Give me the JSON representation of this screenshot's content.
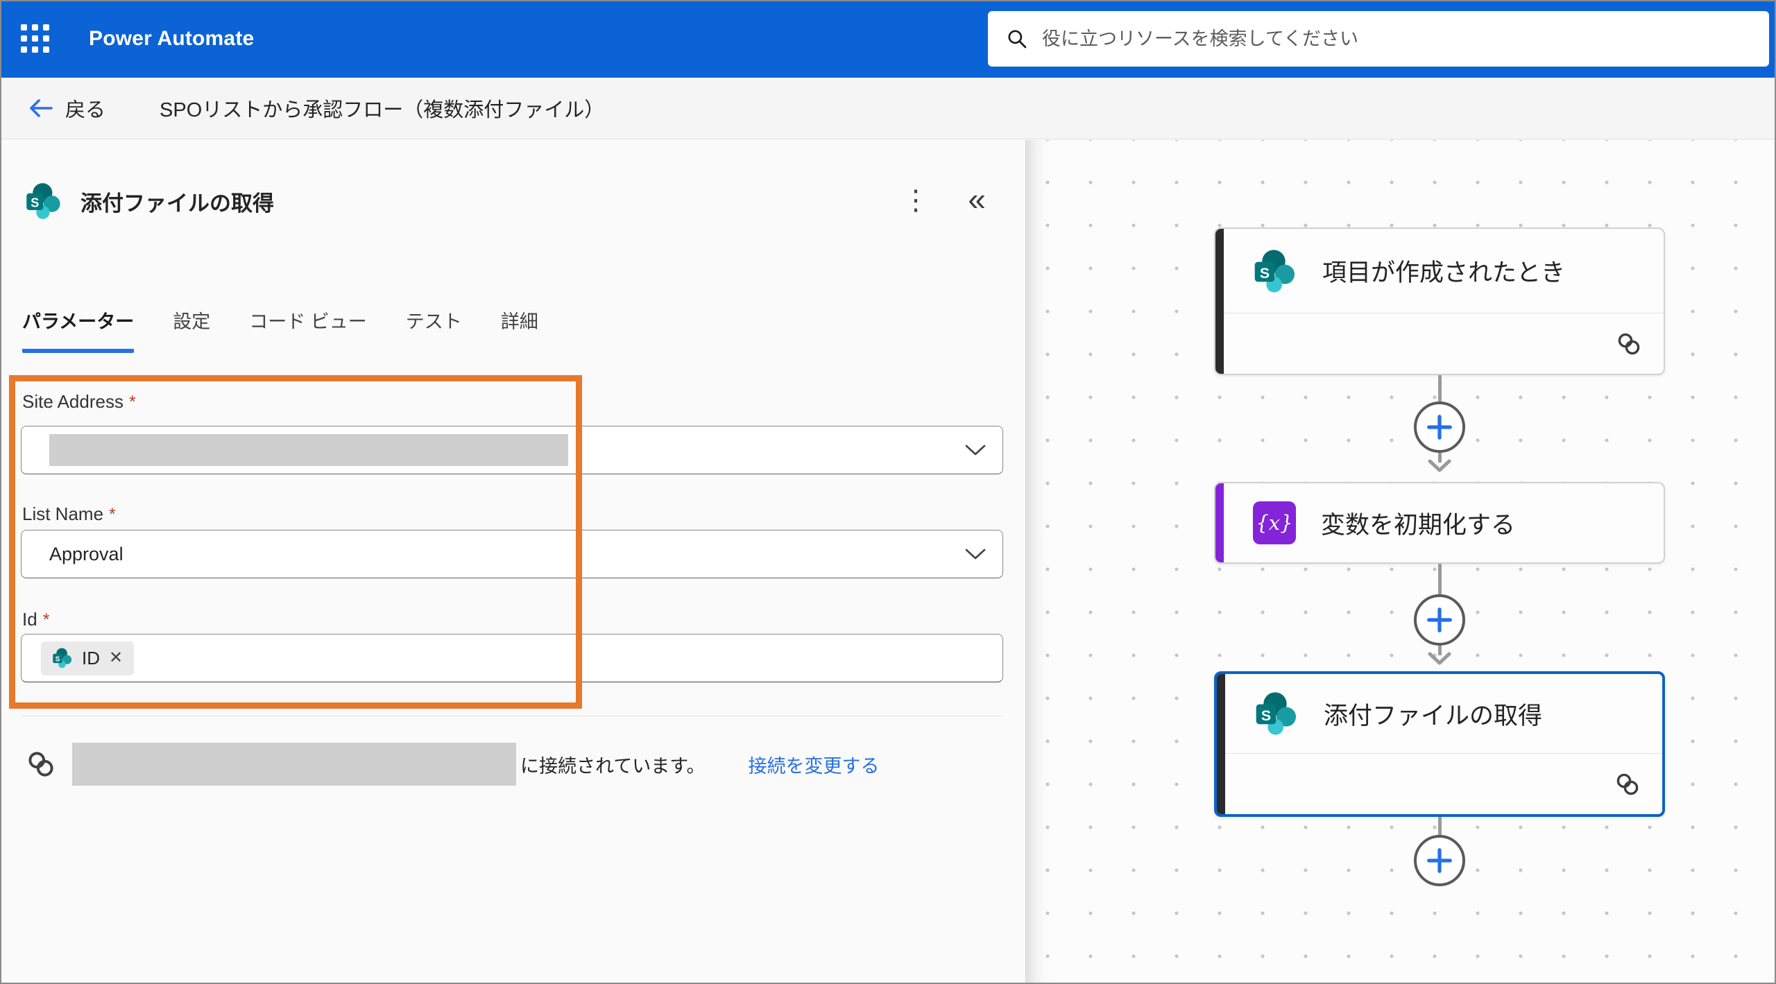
{
  "topbar": {
    "app_title": "Power Automate",
    "search_placeholder": "役に立つリソースを検索してください"
  },
  "breadcrumb": {
    "back_label": "戻る",
    "flow_title": "SPOリストから承認フロー（複数添付ファイル）"
  },
  "panel": {
    "title": "添付ファイルの取得",
    "tabs": [
      {
        "label": "パラメーター",
        "active": true
      },
      {
        "label": "設定",
        "active": false
      },
      {
        "label": "コード ビュー",
        "active": false
      },
      {
        "label": "テスト",
        "active": false
      },
      {
        "label": "詳細",
        "active": false
      }
    ],
    "fields": {
      "site_address": {
        "label": "Site Address",
        "required_mark": "*",
        "value": "",
        "value_redacted": true
      },
      "list_name": {
        "label": "List Name",
        "required_mark": "*",
        "value": "Approval"
      },
      "id": {
        "label": "Id",
        "required_mark": "*",
        "token": {
          "text": "ID",
          "remove_label": "✕",
          "icon": "sharepoint-icon"
        }
      }
    },
    "connection": {
      "account_redacted": true,
      "status_text": "に接続されています。",
      "change_link_label": "接続を変更する"
    }
  },
  "canvas": {
    "nodes": [
      {
        "title": "項目が作成されたとき",
        "icon": "sharepoint-icon",
        "accent_color": "#2B2B2B",
        "selected": false,
        "footer_link_icon": true
      },
      {
        "title": "変数を初期化する",
        "icon": "variable-icon",
        "accent_color": "#8324D9",
        "selected": false,
        "footer_link_icon": false
      },
      {
        "title": "添付ファイルの取得",
        "icon": "sharepoint-icon",
        "accent_color": "#2B2B2B",
        "selected": true,
        "footer_link_icon": true
      }
    ]
  },
  "icons": {
    "more": "⋮",
    "collapse": "«",
    "variable_glyph": "{x}"
  },
  "colors": {
    "brand_blue": "#0C63D6",
    "selected_node_blue": "#0E62C9",
    "action_blue": "#2470E4",
    "highlight_orange": "#E8782C",
    "variable_purple": "#8324D9",
    "sharepoint_teal_dark": "#036C70",
    "sharepoint_teal_mid": "#1A9BA1",
    "sharepoint_teal_light": "#37C6D0",
    "redaction_gray": "#CFCFCF"
  }
}
